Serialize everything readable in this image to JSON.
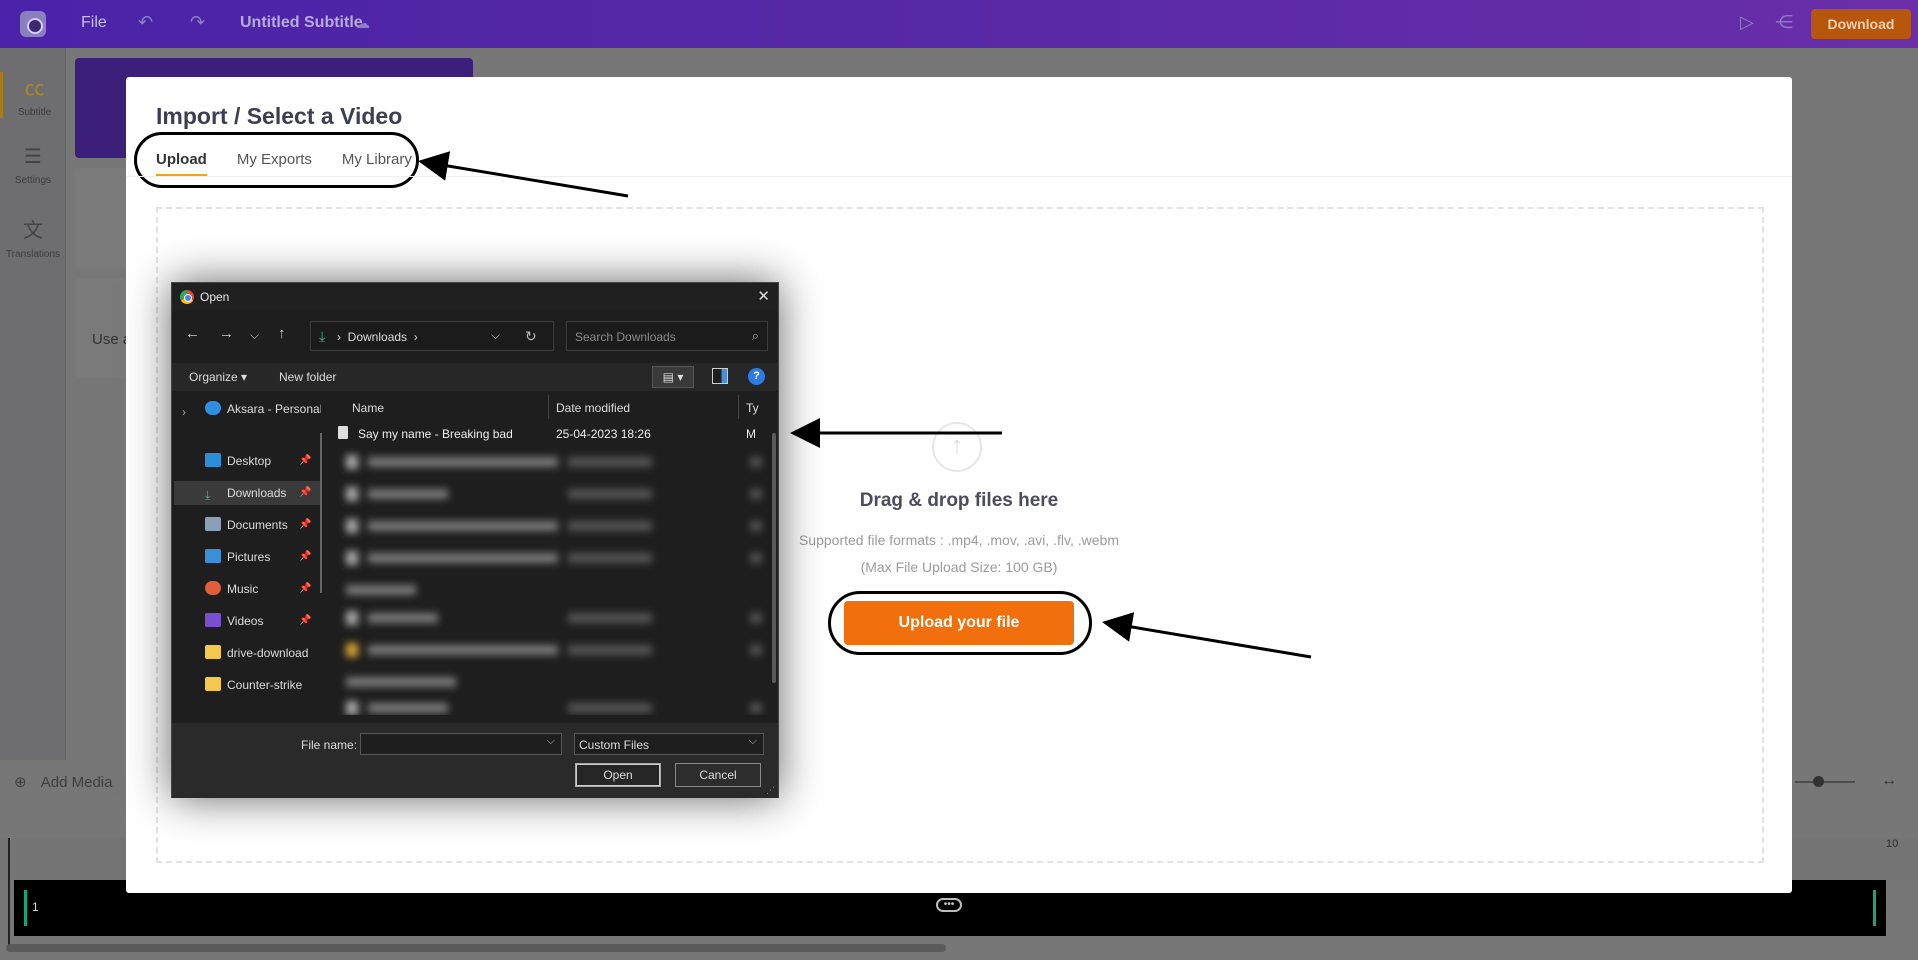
{
  "topbar": {
    "file_menu": "File",
    "title": "Untitled Subtitle",
    "download_label": "Download",
    "accent_color": "#b7570d"
  },
  "sidebar": {
    "items": [
      {
        "label": "Subtitle",
        "icon": "cc-icon",
        "active": true
      },
      {
        "label": "Settings",
        "icon": "sliders-icon",
        "active": false
      },
      {
        "label": "Translations",
        "icon": "translate-icon",
        "active": false
      }
    ]
  },
  "background": {
    "partial_text": "Use a",
    "add_media_label": "Add Media",
    "timeline_number": "1",
    "ruler_label_end": "10"
  },
  "modal": {
    "title": "Import / Select a Video",
    "tabs": [
      {
        "label": "Upload",
        "active": true
      },
      {
        "label": "My Exports",
        "active": false
      },
      {
        "label": "My Library",
        "active": false
      }
    ],
    "drop_title": "Drag & drop files here",
    "formats_text": "Supported file formats : .mp4, .mov, .avi, .flv, .webm",
    "max_size_text": "(Max File Upload Size: 100 GB)",
    "upload_button": "Upload your file",
    "upload_color": "#f26f0e"
  },
  "dialog": {
    "title": "Open",
    "breadcrumb": "Downloads",
    "search_placeholder": "Search Downloads",
    "organize_label": "Organize",
    "new_folder_label": "New folder",
    "nav_items": [
      {
        "label": "Aksara - Personal",
        "icon": "onedrive-icon"
      },
      {
        "label": "Desktop",
        "icon": "desktop-icon",
        "pinned": true
      },
      {
        "label": "Downloads",
        "icon": "download-icon",
        "pinned": true,
        "selected": true
      },
      {
        "label": "Documents",
        "icon": "documents-icon",
        "pinned": true
      },
      {
        "label": "Pictures",
        "icon": "pictures-icon",
        "pinned": true
      },
      {
        "label": "Music",
        "icon": "music-icon",
        "pinned": true
      },
      {
        "label": "Videos",
        "icon": "videos-icon",
        "pinned": true
      },
      {
        "label": "drive-download",
        "icon": "folder-icon"
      },
      {
        "label": "Counter-strike",
        "icon": "folder-icon"
      }
    ],
    "columns": {
      "name": "Name",
      "date": "Date modified",
      "type": "Ty"
    },
    "first_file": {
      "name": "Say my name - Breaking bad",
      "date": "25-04-2023 18:26",
      "type": "M"
    },
    "file_name_label": "File name:",
    "file_type_value": "Custom Files",
    "open_button": "Open",
    "cancel_button": "Cancel"
  }
}
